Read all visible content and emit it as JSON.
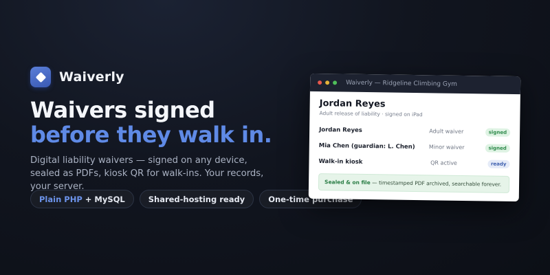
{
  "brand": {
    "name": "Waiverly"
  },
  "hero": {
    "headline_line1": "Waivers signed",
    "headline_line2": "before they walk in.",
    "subtitle": "Digital liability waivers — signed on any device, sealed as PDFs, kiosk QR for walk-ins. Your records, your server."
  },
  "pills": [
    {
      "accent": "Plain PHP",
      "label": "+ MySQL"
    },
    {
      "label": "Shared-hosting ready"
    },
    {
      "label": "One-time purchase"
    }
  ],
  "window": {
    "title": "Waiverly — Ridgeline Climbing Gym",
    "person_name": "Jordan Reyes",
    "person_sub": "Adult release of liability · signed on iPad",
    "rows": [
      {
        "name": "Jordan Reyes",
        "type": "Adult waiver",
        "status": "signed"
      },
      {
        "name": "Mia Chen (guardian: L. Chen)",
        "type": "Minor waiver",
        "status": "signed"
      },
      {
        "name": "Walk-in kiosk",
        "type": "QR active",
        "status": "ready"
      }
    ],
    "notice_strong": "Sealed & on file",
    "notice_text": " — timestamped PDF archived, searchable forever."
  },
  "colors": {
    "accent": "#5f8ae6",
    "signed_badge": "#2e8a4b",
    "ready_badge": "#3d5fae"
  }
}
